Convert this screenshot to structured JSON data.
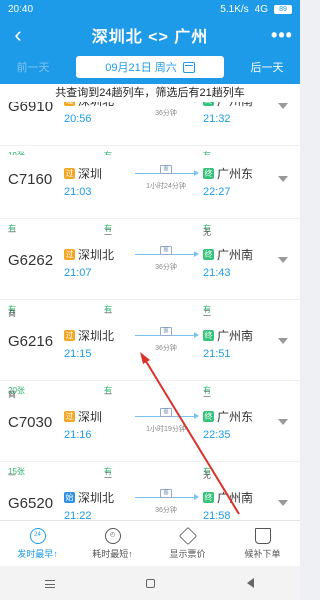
{
  "status": {
    "time": "20:40",
    "speed": "5.1K/s",
    "network": "4G",
    "battery": "89"
  },
  "header": {
    "title": "深圳北 <> 广州",
    "back_icon": "back-arrow-icon",
    "more": "•••"
  },
  "datebar": {
    "prev": "前一天",
    "date": "09月21日 周六",
    "next": "后一天"
  },
  "summary": "共查询到24趟列车，筛选后有21趟列车",
  "trains": [
    {
      "no": "G6910",
      "from": "深圳北",
      "from_type": "过",
      "dep": "20:56",
      "to": "广州南",
      "to_type": "终",
      "arr": "21:32",
      "duration": "36分钟",
      "seats": [
        {
          "label": "商务:",
          "value": "19张"
        },
        {
          "label": "一等:",
          "value": "有"
        },
        {
          "label": "二等:",
          "value": "有"
        }
      ]
    },
    {
      "no": "C7160",
      "from": "深圳",
      "from_type": "过",
      "dep": "21:03",
      "to": "广州东",
      "to_type": "终",
      "arr": "22:27",
      "duration": "1小时24分钟",
      "seats": [
        {
          "label": "一等:",
          "value": "有"
        },
        {
          "label": "二等:",
          "value": "有"
        },
        {
          "label": "无座:",
          "value": "有"
        }
      ]
    },
    {
      "no": "G6262",
      "from": "深圳北",
      "from_type": "过",
      "dep": "21:07",
      "to": "广州南",
      "to_type": "终",
      "arr": "21:43",
      "duration": "36分钟",
      "seats": [
        {
          "label": "商务:",
          "value": "有"
        },
        {
          "label": "一等:",
          "value": "有"
        },
        {
          "label": "二等:",
          "value": "有"
        }
      ]
    },
    {
      "no": "G6216",
      "from": "深圳北",
      "from_type": "过",
      "dep": "21:15",
      "to": "广州南",
      "to_type": "终",
      "arr": "21:51",
      "duration": "36分钟",
      "seats": [
        {
          "label": "商务:",
          "value": "20张"
        },
        {
          "label": "一等:",
          "value": "有"
        },
        {
          "label": "二等:",
          "value": "有"
        }
      ]
    },
    {
      "no": "C7030",
      "from": "深圳",
      "from_type": "过",
      "dep": "21:16",
      "to": "广州东",
      "to_type": "终",
      "arr": "22:35",
      "duration": "1小时19分钟",
      "seats": [
        {
          "label": "一等:",
          "value": "15张"
        },
        {
          "label": "二等:",
          "value": "有"
        },
        {
          "label": "无座:",
          "value": "有"
        }
      ]
    },
    {
      "no": "G6520",
      "from": "深圳北",
      "from_type": "始",
      "dep": "21:22",
      "to": "广州南",
      "to_type": "终",
      "arr": "21:58",
      "duration": "36分钟",
      "seats": []
    }
  ],
  "route_tag": "图",
  "bottom_tabs": [
    {
      "label": "发时最早↑",
      "icon": "clock-early-icon",
      "glyph": "24"
    },
    {
      "label": "耗时最短↑",
      "icon": "stopwatch-icon",
      "glyph": "◴"
    },
    {
      "label": "显示票价",
      "icon": "price-tag-icon",
      "glyph": ""
    },
    {
      "label": "候补下单",
      "icon": "cart-icon",
      "glyph": ""
    }
  ],
  "colors": {
    "primary": "#1e9be8",
    "available": "#2eb56d",
    "annotation_arrow": "#d9342b"
  }
}
